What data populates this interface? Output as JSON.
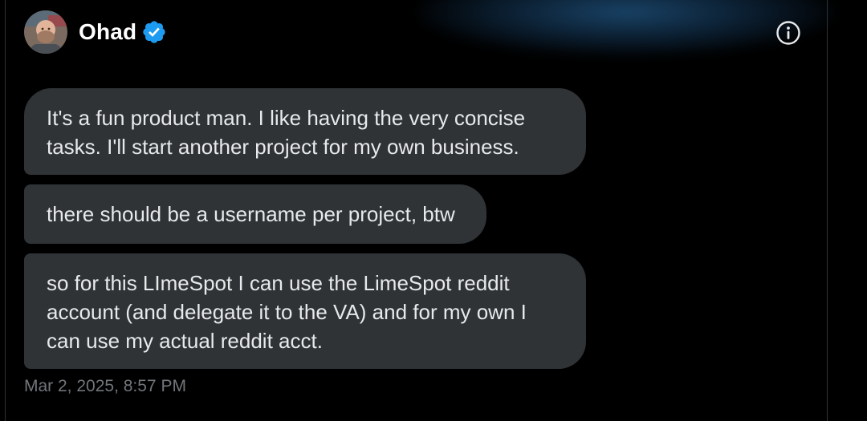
{
  "header": {
    "name": "Ohad",
    "verified": true,
    "avatar_icon": "user-avatar-photo",
    "info_icon": "info-icon"
  },
  "messages": [
    {
      "text": "It's a fun product man. I like having the very concise\ntasks. I'll start another project for my own business."
    },
    {
      "text": "there should be a username per project, btw"
    },
    {
      "text": "so for this LImeSpot I can use the LimeSpot reddit\naccount (and delegate it to the VA) and for my own I\ncan use my actual reddit acct."
    }
  ],
  "timestamp": "Mar 2, 2025, 8:57 PM",
  "colors": {
    "background": "#000000",
    "bubble": "#2f3336",
    "text": "#e7e9ea",
    "muted": "#71767b",
    "verified": "#1d9bf0"
  }
}
